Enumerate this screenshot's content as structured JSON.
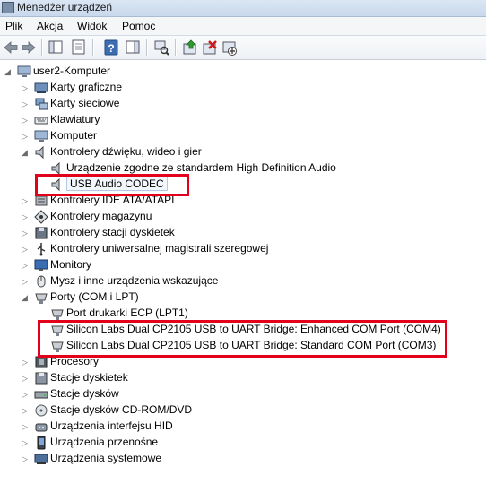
{
  "window": {
    "title": "Menedżer urządzeń"
  },
  "menu": [
    "Plik",
    "Akcja",
    "Widok",
    "Pomoc"
  ],
  "toolbar": {
    "buttons": [
      "back-arrow-icon",
      "forward-arrow-icon",
      "console-tree-icon",
      "properties-icon",
      "help-icon",
      "action-pane-icon",
      "scan-hardware-icon",
      "update-driver-icon",
      "uninstall-icon",
      "disable-icon"
    ]
  },
  "tree": {
    "root": "user2-Komputer",
    "items": [
      {
        "label": "Karty graficzne",
        "level": 1,
        "expander": "collapsed",
        "icon": "display-adapter-icon"
      },
      {
        "label": "Karty sieciowe",
        "level": 1,
        "expander": "collapsed",
        "icon": "network-adapter-icon"
      },
      {
        "label": "Klawiatury",
        "level": 1,
        "expander": "collapsed",
        "icon": "keyboard-icon"
      },
      {
        "label": "Komputer",
        "level": 1,
        "expander": "collapsed",
        "icon": "computer-icon"
      },
      {
        "label": "Kontrolery dźwięku, wideo i gier",
        "level": 1,
        "expander": "expanded",
        "icon": "speaker-icon"
      },
      {
        "label": "Urządzenie zgodne ze standardem High Definition Audio",
        "level": 2,
        "expander": "none",
        "icon": "speaker-icon"
      },
      {
        "label": "USB Audio CODEC",
        "level": 2,
        "expander": "none",
        "icon": "speaker-icon",
        "selected": true
      },
      {
        "label": "Kontrolery IDE ATA/ATAPI",
        "level": 1,
        "expander": "collapsed",
        "icon": "ide-controller-icon"
      },
      {
        "label": "Kontrolery magazynu",
        "level": 1,
        "expander": "collapsed",
        "icon": "storage-controller-icon"
      },
      {
        "label": "Kontrolery stacji dyskietek",
        "level": 1,
        "expander": "collapsed",
        "icon": "floppy-controller-icon"
      },
      {
        "label": "Kontrolery uniwersalnej magistrali szeregowej",
        "level": 1,
        "expander": "collapsed",
        "icon": "usb-icon"
      },
      {
        "label": "Monitory",
        "level": 1,
        "expander": "collapsed",
        "icon": "monitor-icon"
      },
      {
        "label": "Mysz i inne urządzenia wskazujące",
        "level": 1,
        "expander": "collapsed",
        "icon": "mouse-icon"
      },
      {
        "label": "Porty (COM i LPT)",
        "level": 1,
        "expander": "expanded",
        "icon": "port-icon"
      },
      {
        "label": "Port drukarki ECP (LPT1)",
        "level": 2,
        "expander": "none",
        "icon": "port-icon"
      },
      {
        "label": "Silicon Labs Dual CP2105 USB to UART Bridge: Enhanced COM Port (COM4)",
        "level": 2,
        "expander": "none",
        "icon": "port-icon"
      },
      {
        "label": "Silicon Labs Dual CP2105 USB to UART Bridge: Standard COM Port (COM3)",
        "level": 2,
        "expander": "none",
        "icon": "port-icon"
      },
      {
        "label": "Procesory",
        "level": 1,
        "expander": "collapsed",
        "icon": "processor-icon"
      },
      {
        "label": "Stacje dyskietek",
        "level": 1,
        "expander": "collapsed",
        "icon": "floppy-drive-icon"
      },
      {
        "label": "Stacje dysków",
        "level": 1,
        "expander": "collapsed",
        "icon": "disk-drive-icon"
      },
      {
        "label": "Stacje dysków CD-ROM/DVD",
        "level": 1,
        "expander": "collapsed",
        "icon": "cdrom-icon"
      },
      {
        "label": "Urządzenia interfejsu HID",
        "level": 1,
        "expander": "collapsed",
        "icon": "hid-icon"
      },
      {
        "label": "Urządzenia przenośne",
        "level": 1,
        "expander": "collapsed",
        "icon": "portable-device-icon"
      },
      {
        "label": "Urządzenia systemowe",
        "level": 1,
        "expander": "collapsed",
        "icon": "system-device-icon"
      }
    ]
  },
  "colors": {
    "highlight": "#e2001a",
    "accent": "#3c6db0"
  }
}
